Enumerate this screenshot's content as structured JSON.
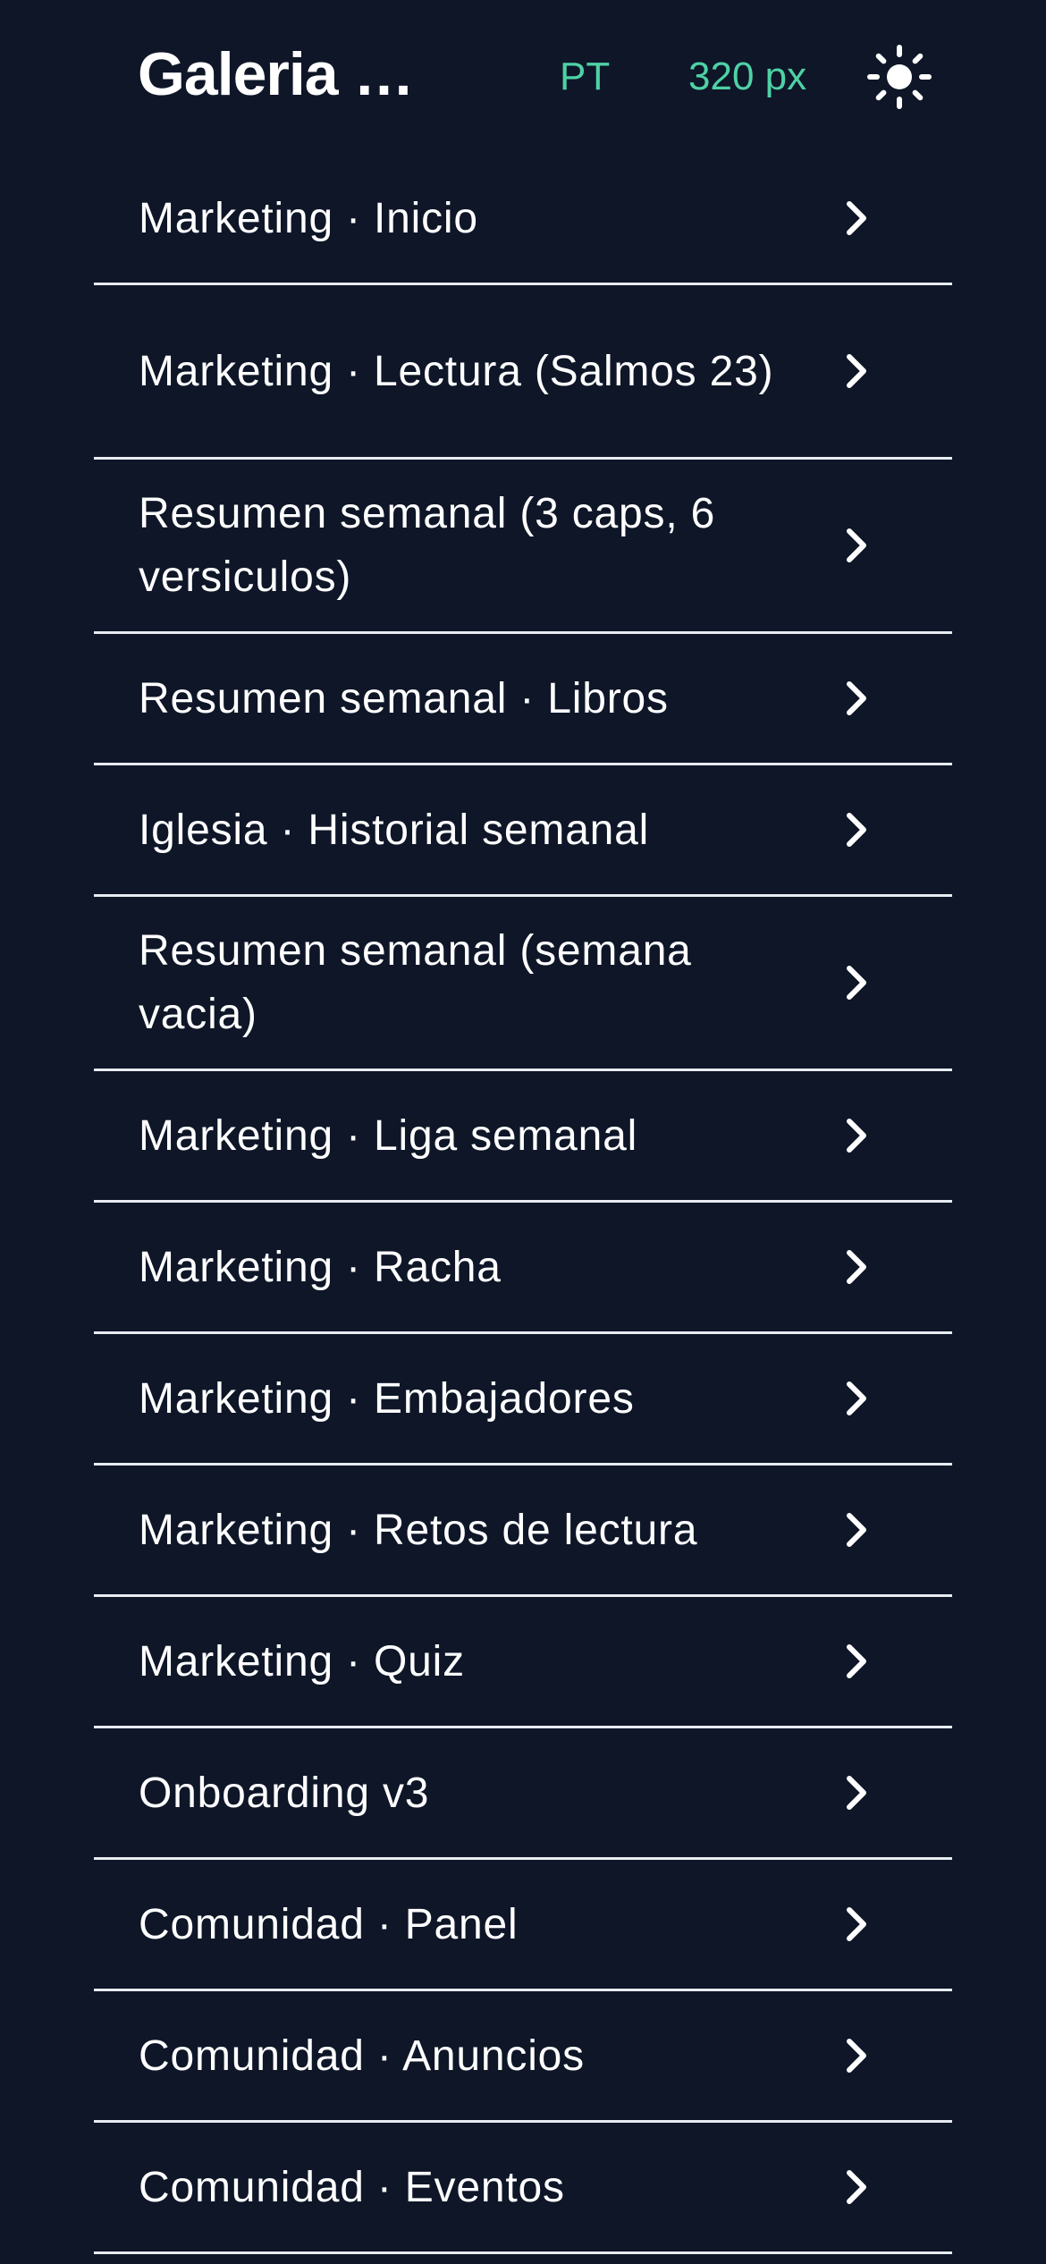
{
  "header": {
    "title": "Galeria — Pantallas",
    "language": "PT",
    "viewport_width": "320 px",
    "theme_icon": "sun-icon"
  },
  "colors": {
    "background": "#0e1628",
    "accent": "#4fd1a5",
    "text": "#ffffff",
    "divider": "#e8ecf2"
  },
  "list": {
    "items": [
      {
        "label": "Marketing · Inicio"
      },
      {
        "label": "Marketing · Lectura (Salmos 23)"
      },
      {
        "label": "Resumen semanal (3 caps, 6 versiculos)"
      },
      {
        "label": "Resumen semanal · Libros"
      },
      {
        "label": "Iglesia · Historial semanal"
      },
      {
        "label": "Resumen semanal (semana vacia)"
      },
      {
        "label": "Marketing · Liga semanal"
      },
      {
        "label": "Marketing · Racha"
      },
      {
        "label": "Marketing · Embajadores"
      },
      {
        "label": "Marketing · Retos de lectura"
      },
      {
        "label": "Marketing · Quiz"
      },
      {
        "label": "Onboarding v3"
      },
      {
        "label": "Comunidad · Panel"
      },
      {
        "label": "Comunidad · Anuncios"
      },
      {
        "label": "Comunidad · Eventos"
      }
    ]
  }
}
